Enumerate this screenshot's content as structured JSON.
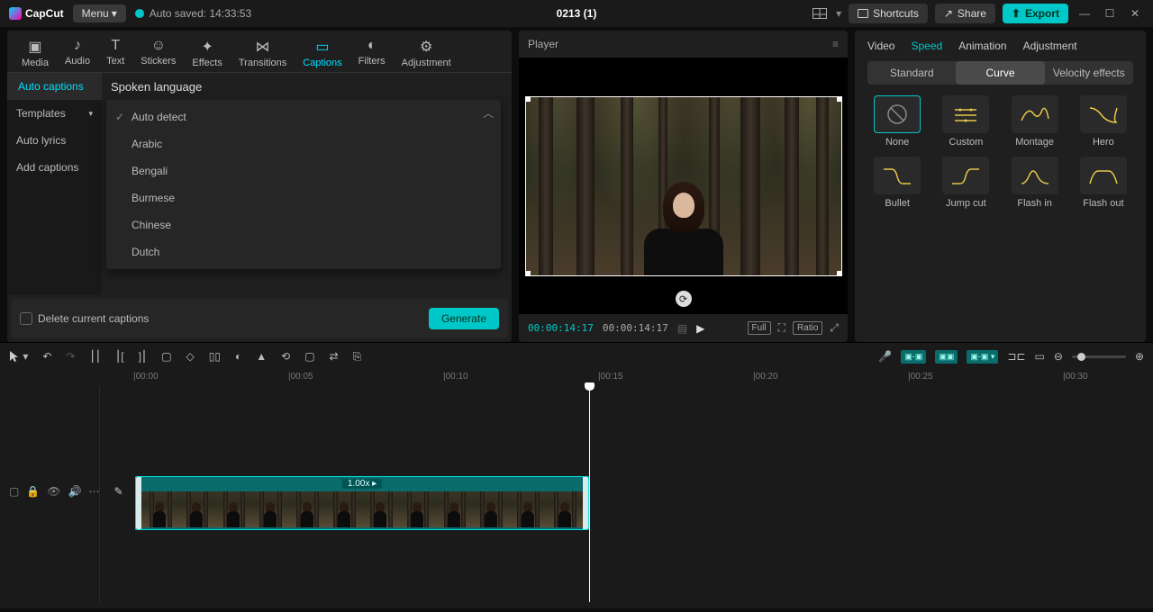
{
  "app": {
    "name": "CapCut",
    "menu": "Menu",
    "autosave": "Auto saved: 14:33:53",
    "project": "0213 (1)"
  },
  "topbar": {
    "shortcuts": "Shortcuts",
    "share": "Share",
    "export": "Export"
  },
  "leftTabs": [
    "Media",
    "Audio",
    "Text",
    "Stickers",
    "Effects",
    "Transitions",
    "Captions",
    "Filters",
    "Adjustment"
  ],
  "leftTabsActive": 6,
  "leftSidebar": {
    "items": [
      "Auto captions",
      "Templates",
      "Auto lyrics",
      "Add captions"
    ],
    "active": 0
  },
  "captions": {
    "label": "Spoken language",
    "selected": "Auto detect",
    "options": [
      "Auto detect",
      "Arabic",
      "Bengali",
      "Burmese",
      "Chinese",
      "Dutch"
    ],
    "deleteLabel": "Delete current captions",
    "generate": "Generate"
  },
  "player": {
    "title": "Player",
    "current": "00:00:14:17",
    "total": "00:00:14:17",
    "full": "Full",
    "ratio": "Ratio"
  },
  "inspector": {
    "tabs": [
      "Video",
      "Speed",
      "Animation",
      "Adjustment"
    ],
    "active": 1,
    "seg": [
      "Standard",
      "Curve",
      "Velocity effects"
    ],
    "segActive": 1,
    "curves": [
      "None",
      "Custom",
      "Montage",
      "Hero",
      "Bullet",
      "Jump cut",
      "Flash in",
      "Flash out"
    ]
  },
  "timeline": {
    "marks": [
      "00:00",
      "00:05",
      "00:10",
      "00:15",
      "00:20",
      "00:25",
      "00:30"
    ],
    "clipLabel": "1.00x ▸"
  }
}
